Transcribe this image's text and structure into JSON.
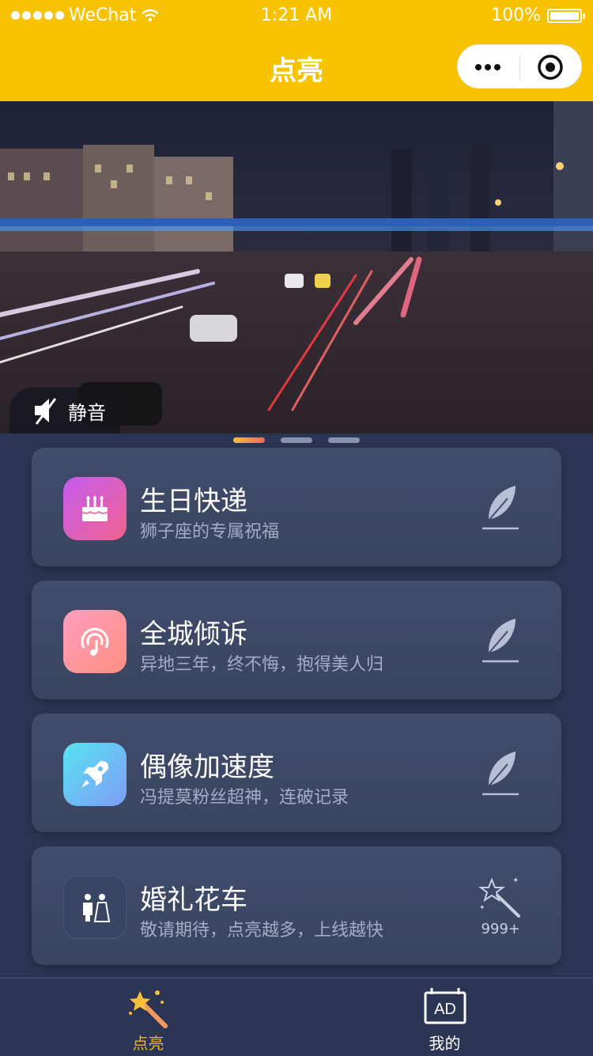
{
  "status_bar": {
    "carrier": "WeChat",
    "time": "1:21 AM",
    "battery": "100%"
  },
  "nav": {
    "title": "点亮"
  },
  "banner": {
    "mute_label": "静音",
    "pages": 3,
    "active_page": 1
  },
  "cards": [
    {
      "title": "生日快递",
      "subtitle": "狮子座的专属祝福",
      "icon": "birthday-cake-icon",
      "action_icon": "feather-icon"
    },
    {
      "title": "全城倾诉",
      "subtitle": "异地三年，终不悔，抱得美人归",
      "icon": "music-broadcast-icon",
      "action_icon": "feather-icon"
    },
    {
      "title": "偶像加速度",
      "subtitle": "冯提莫粉丝超神，连破记录",
      "icon": "rocket-icon",
      "action_icon": "feather-icon"
    },
    {
      "title": "婚礼花车",
      "subtitle": "敬请期待，点亮越多，上线越快",
      "icon": "wedding-couple-icon",
      "action_icon": "magic-wand-icon",
      "action_count": "999+"
    }
  ],
  "tabbar": {
    "items": [
      {
        "label": "点亮",
        "icon": "magic-wand-icon",
        "active": true
      },
      {
        "label": "我的",
        "icon": "ad-billboard-icon",
        "active": false
      }
    ]
  },
  "colors": {
    "brand_yellow": "#f7c200",
    "background": "#2c3553",
    "card": "#3d4866",
    "active_tab": "#f5b70f",
    "inactive_tab": "#ffffff"
  }
}
